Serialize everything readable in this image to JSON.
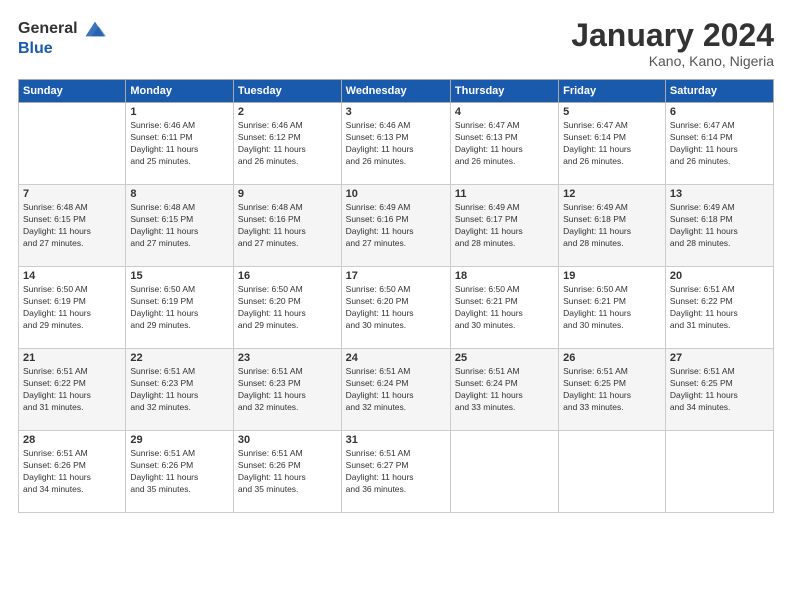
{
  "header": {
    "logo_line1": "General",
    "logo_line2": "Blue",
    "title": "January 2024",
    "subtitle": "Kano, Kano, Nigeria"
  },
  "days_of_week": [
    "Sunday",
    "Monday",
    "Tuesday",
    "Wednesday",
    "Thursday",
    "Friday",
    "Saturday"
  ],
  "weeks": [
    [
      {
        "day": "",
        "info": ""
      },
      {
        "day": "1",
        "info": "Sunrise: 6:46 AM\nSunset: 6:11 PM\nDaylight: 11 hours\nand 25 minutes."
      },
      {
        "day": "2",
        "info": "Sunrise: 6:46 AM\nSunset: 6:12 PM\nDaylight: 11 hours\nand 26 minutes."
      },
      {
        "day": "3",
        "info": "Sunrise: 6:46 AM\nSunset: 6:13 PM\nDaylight: 11 hours\nand 26 minutes."
      },
      {
        "day": "4",
        "info": "Sunrise: 6:47 AM\nSunset: 6:13 PM\nDaylight: 11 hours\nand 26 minutes."
      },
      {
        "day": "5",
        "info": "Sunrise: 6:47 AM\nSunset: 6:14 PM\nDaylight: 11 hours\nand 26 minutes."
      },
      {
        "day": "6",
        "info": "Sunrise: 6:47 AM\nSunset: 6:14 PM\nDaylight: 11 hours\nand 26 minutes."
      }
    ],
    [
      {
        "day": "7",
        "info": "Sunrise: 6:48 AM\nSunset: 6:15 PM\nDaylight: 11 hours\nand 27 minutes."
      },
      {
        "day": "8",
        "info": "Sunrise: 6:48 AM\nSunset: 6:15 PM\nDaylight: 11 hours\nand 27 minutes."
      },
      {
        "day": "9",
        "info": "Sunrise: 6:48 AM\nSunset: 6:16 PM\nDaylight: 11 hours\nand 27 minutes."
      },
      {
        "day": "10",
        "info": "Sunrise: 6:49 AM\nSunset: 6:16 PM\nDaylight: 11 hours\nand 27 minutes."
      },
      {
        "day": "11",
        "info": "Sunrise: 6:49 AM\nSunset: 6:17 PM\nDaylight: 11 hours\nand 28 minutes."
      },
      {
        "day": "12",
        "info": "Sunrise: 6:49 AM\nSunset: 6:18 PM\nDaylight: 11 hours\nand 28 minutes."
      },
      {
        "day": "13",
        "info": "Sunrise: 6:49 AM\nSunset: 6:18 PM\nDaylight: 11 hours\nand 28 minutes."
      }
    ],
    [
      {
        "day": "14",
        "info": "Sunrise: 6:50 AM\nSunset: 6:19 PM\nDaylight: 11 hours\nand 29 minutes."
      },
      {
        "day": "15",
        "info": "Sunrise: 6:50 AM\nSunset: 6:19 PM\nDaylight: 11 hours\nand 29 minutes."
      },
      {
        "day": "16",
        "info": "Sunrise: 6:50 AM\nSunset: 6:20 PM\nDaylight: 11 hours\nand 29 minutes."
      },
      {
        "day": "17",
        "info": "Sunrise: 6:50 AM\nSunset: 6:20 PM\nDaylight: 11 hours\nand 30 minutes."
      },
      {
        "day": "18",
        "info": "Sunrise: 6:50 AM\nSunset: 6:21 PM\nDaylight: 11 hours\nand 30 minutes."
      },
      {
        "day": "19",
        "info": "Sunrise: 6:50 AM\nSunset: 6:21 PM\nDaylight: 11 hours\nand 30 minutes."
      },
      {
        "day": "20",
        "info": "Sunrise: 6:51 AM\nSunset: 6:22 PM\nDaylight: 11 hours\nand 31 minutes."
      }
    ],
    [
      {
        "day": "21",
        "info": "Sunrise: 6:51 AM\nSunset: 6:22 PM\nDaylight: 11 hours\nand 31 minutes."
      },
      {
        "day": "22",
        "info": "Sunrise: 6:51 AM\nSunset: 6:23 PM\nDaylight: 11 hours\nand 32 minutes."
      },
      {
        "day": "23",
        "info": "Sunrise: 6:51 AM\nSunset: 6:23 PM\nDaylight: 11 hours\nand 32 minutes."
      },
      {
        "day": "24",
        "info": "Sunrise: 6:51 AM\nSunset: 6:24 PM\nDaylight: 11 hours\nand 32 minutes."
      },
      {
        "day": "25",
        "info": "Sunrise: 6:51 AM\nSunset: 6:24 PM\nDaylight: 11 hours\nand 33 minutes."
      },
      {
        "day": "26",
        "info": "Sunrise: 6:51 AM\nSunset: 6:25 PM\nDaylight: 11 hours\nand 33 minutes."
      },
      {
        "day": "27",
        "info": "Sunrise: 6:51 AM\nSunset: 6:25 PM\nDaylight: 11 hours\nand 34 minutes."
      }
    ],
    [
      {
        "day": "28",
        "info": "Sunrise: 6:51 AM\nSunset: 6:26 PM\nDaylight: 11 hours\nand 34 minutes."
      },
      {
        "day": "29",
        "info": "Sunrise: 6:51 AM\nSunset: 6:26 PM\nDaylight: 11 hours\nand 35 minutes."
      },
      {
        "day": "30",
        "info": "Sunrise: 6:51 AM\nSunset: 6:26 PM\nDaylight: 11 hours\nand 35 minutes."
      },
      {
        "day": "31",
        "info": "Sunrise: 6:51 AM\nSunset: 6:27 PM\nDaylight: 11 hours\nand 36 minutes."
      },
      {
        "day": "",
        "info": ""
      },
      {
        "day": "",
        "info": ""
      },
      {
        "day": "",
        "info": ""
      }
    ]
  ]
}
